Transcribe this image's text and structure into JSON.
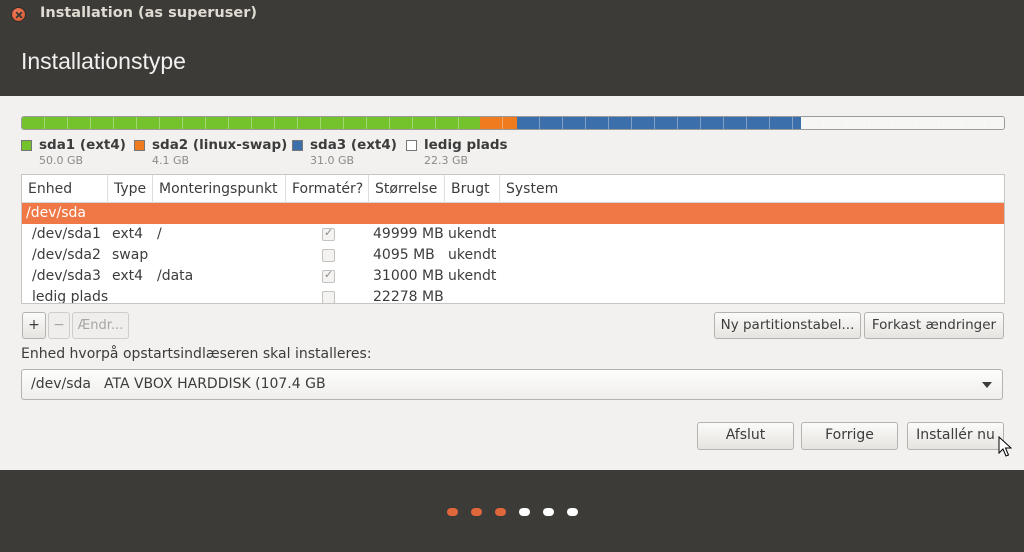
{
  "window": {
    "title": "Installation (as superuser)"
  },
  "header": {
    "title": "Installationstype"
  },
  "colors": {
    "sda1": "#74c22c",
    "sda2": "#f07a1e",
    "sda3": "#3b6fab",
    "free": "#f6f6f5",
    "selected_row": "#f07746"
  },
  "partition_bar": [
    {
      "name": "sda1",
      "fraction": 0.466,
      "color": "#74c22c"
    },
    {
      "name": "sda2",
      "fraction": 0.038,
      "color": "#f07a1e"
    },
    {
      "name": "sda3",
      "fraction": 0.289,
      "color": "#3b6fab"
    },
    {
      "name": "free",
      "fraction": 0.207,
      "color": "#f6f6f5"
    }
  ],
  "legend": [
    {
      "label": "sda1 (ext4)",
      "size": "50.0 GB",
      "color": "#74c22c"
    },
    {
      "label": "sda2 (linux-swap)",
      "size": "4.1 GB",
      "color": "#f07a1e"
    },
    {
      "label": "sda3 (ext4)",
      "size": "31.0 GB",
      "color": "#3b6fab"
    },
    {
      "label": "ledig plads",
      "size": "22.3 GB",
      "color": "#ffffff"
    }
  ],
  "table": {
    "columns": [
      "Enhed",
      "Type",
      "Monteringspunkt",
      "Formatér?",
      "Størrelse",
      "Brugt",
      "System"
    ],
    "selected_device": "/dev/sda",
    "rows": [
      {
        "device": "/dev/sda1",
        "type": "ext4",
        "mount": "/",
        "format": true,
        "size": "49999 MB",
        "used": "ukendt",
        "system": ""
      },
      {
        "device": "/dev/sda2",
        "type": "swap",
        "mount": "",
        "format": false,
        "size": "4095 MB",
        "used": "ukendt",
        "system": ""
      },
      {
        "device": "/dev/sda3",
        "type": "ext4",
        "mount": "/data",
        "format": true,
        "size": "31000 MB",
        "used": "ukendt",
        "system": ""
      },
      {
        "device": "ledig plads",
        "type": "",
        "mount": "",
        "format": false,
        "size": "22278 MB",
        "used": "",
        "system": ""
      }
    ]
  },
  "toolbar": {
    "add_label": "+",
    "remove_label": "−",
    "change_label": "Ændr...",
    "new_table_label": "Ny partitionstabel...",
    "revert_label": "Forkast ændringer"
  },
  "bootloader": {
    "label": "Enhed hvorpå opstartsindlæseren skal installeres:",
    "device": "/dev/sda",
    "model": "ATA VBOX HARDDISK (107.4 GB"
  },
  "buttons": {
    "quit": "Afslut",
    "back": "Forrige",
    "install": "Installér nu"
  },
  "progress": {
    "total_steps": 6,
    "current_step": 3,
    "active_color": "#e0663c",
    "inactive_color": "#ffffff"
  }
}
